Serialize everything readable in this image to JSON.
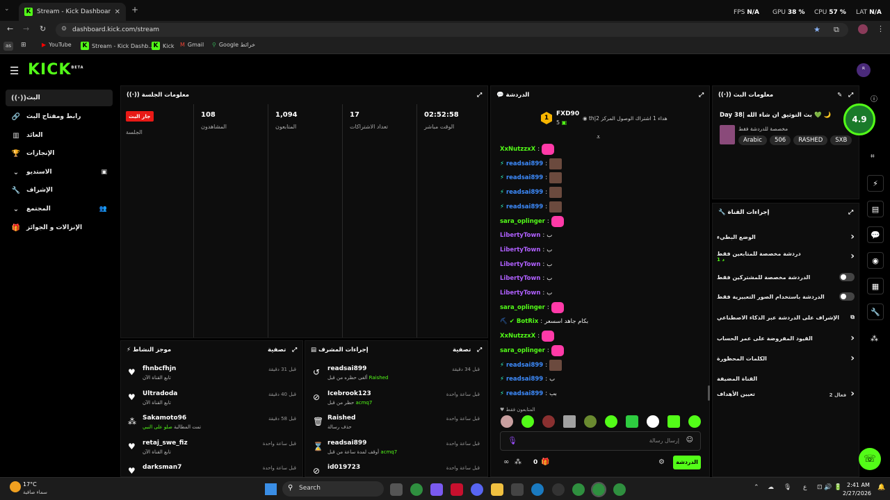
{
  "browser": {
    "tab_title": "Stream - Kick Dashboard",
    "url": "dashboard.kick.com/stream",
    "stats": {
      "fps_label": "FPS",
      "fps": "N/A",
      "gpu_label": "GPU",
      "gpu": "38 %",
      "cpu_label": "CPU",
      "cpu": "57 %",
      "lat_label": "LAT",
      "lat": "N/A"
    },
    "profile_initials": "as",
    "bookmarks": [
      "YouTube",
      "Stream - Kick Dashb...",
      "Kick",
      "Gmail",
      "Google خرائط"
    ]
  },
  "brand": {
    "logo": "KICK",
    "beta": "BETA"
  },
  "sidebar": {
    "items": [
      {
        "label": "البث",
        "icon": "broadcast-icon",
        "glyph": "((·))"
      },
      {
        "label": "رابط ومفتاح البث",
        "icon": "link-icon",
        "glyph": "🔗"
      },
      {
        "label": "العائد",
        "icon": "chart-icon",
        "glyph": "▥"
      },
      {
        "label": "الإنجازات",
        "icon": "trophy-icon",
        "glyph": "🏆"
      },
      {
        "label": "الاستديو",
        "icon": "chevron-down-icon",
        "glyph": "⌄"
      },
      {
        "label": "الإشراف",
        "icon": "wrench-icon",
        "glyph": "🔧"
      },
      {
        "label": "المجتمع",
        "icon": "chevron-down-icon",
        "glyph": "⌄"
      },
      {
        "label": "الإنزالات و الجوائز",
        "icon": "gift-icon",
        "glyph": "🎁"
      }
    ]
  },
  "session": {
    "title": "معلومات الجلسة",
    "live_badge": "جار البث",
    "session_label": "الجلسة",
    "stats": [
      {
        "value": "108",
        "label": "المشاهدون"
      },
      {
        "value": "1,094",
        "label": "المتابعون"
      },
      {
        "value": "17",
        "label": "تعداد الاشتراكات"
      },
      {
        "value": "02:52:58",
        "label": "الوقت مباشر"
      }
    ]
  },
  "chat": {
    "title": "الدردشة",
    "pinned_user": "FXD90",
    "pinned_rank": "1",
    "pinned_count": "5",
    "pinned_note": "th|هداء 1 اشتراك الوصول المركز 2",
    "messages": [
      {
        "user": "XxNutzzxX",
        "color": "green",
        "text": "",
        "emote": "pink"
      },
      {
        "user": "readsai899",
        "color": "blue",
        "text": "",
        "emote": "face"
      },
      {
        "user": "readsai899",
        "color": "blue",
        "text": "",
        "emote": "face"
      },
      {
        "user": "readsai899",
        "color": "blue",
        "text": "",
        "emote": "face"
      },
      {
        "user": "readsai899",
        "color": "blue",
        "text": "",
        "emote": "face"
      },
      {
        "user": "sara_oplinger",
        "color": "green",
        "text": "",
        "emote": "pink"
      },
      {
        "user": "LibertyTown",
        "color": "purple",
        "text": "ب",
        "emote": ""
      },
      {
        "user": "LibertyTown",
        "color": "purple",
        "text": "ب",
        "emote": ""
      },
      {
        "user": "LibertyTown",
        "color": "purple",
        "text": "ب",
        "emote": ""
      },
      {
        "user": "LibertyTown",
        "color": "purple",
        "text": "ب",
        "emote": ""
      },
      {
        "user": "LibertyTown",
        "color": "purple",
        "text": "ب",
        "emote": ""
      },
      {
        "user": "sara_oplinger",
        "color": "green",
        "text": "",
        "emote": "pink"
      },
      {
        "user": "BotRix",
        "color": "green",
        "text": "بكام جاهد اسسعر",
        "emote": ""
      },
      {
        "user": "XxNutzzxX",
        "color": "green",
        "text": "",
        "emote": "pink"
      },
      {
        "user": "sara_oplinger",
        "color": "green",
        "text": "",
        "emote": "pink"
      },
      {
        "user": "readsai899",
        "color": "blue",
        "text": "",
        "emote": "face"
      },
      {
        "user": "readsai899",
        "color": "blue",
        "text": "ب",
        "emote": ""
      },
      {
        "user": "readsai899",
        "color": "blue",
        "text": "بب",
        "emote": ""
      }
    ],
    "followers_only": "المتابعون فقط",
    "input_placeholder": "إرسال رسالة",
    "send_label": "الدردشة",
    "count": "0"
  },
  "activity": {
    "title": "موجز النشاط",
    "filter": "تصفية",
    "events": [
      {
        "user": "fhnbcfhjn",
        "sub": "تابع القناة الآن",
        "time": "قبل 31 دقيقة",
        "icon": "heart-icon",
        "glyph": "♥"
      },
      {
        "user": "Ultradoda",
        "sub": "تابع القناة الآن",
        "time": "قبل 40 دقيقة",
        "icon": "heart-icon",
        "glyph": "♥"
      },
      {
        "user": "Sakamoto96",
        "sub": "تمت المطالبة",
        "hl": "صلو على النبي",
        "time": "قبل 58 دقيقة",
        "icon": "reward-icon",
        "glyph": "⁂"
      },
      {
        "user": "retaj_swe_fiz",
        "sub": "تابع القناة الآن",
        "time": "قبل ساعة واحدة",
        "icon": "heart-icon",
        "glyph": "♥"
      },
      {
        "user": "darksman7",
        "sub": "",
        "time": "قبل ساعة واحدة",
        "icon": "heart-icon",
        "glyph": "♥"
      }
    ]
  },
  "mod_actions": {
    "title": "إجراءات المشرف",
    "filter": "تصفية",
    "events": [
      {
        "user": "readsai899",
        "sub": "ألغى حظره من قبل",
        "hl": "Raished",
        "time": "قبل 34 دقيقة",
        "icon": "undo-icon",
        "glyph": "↺"
      },
      {
        "user": "Icebrook123",
        "sub": "حظر من قبل",
        "hl": "acmq7",
        "time": "قبل ساعة واحدة",
        "icon": "ban-icon",
        "glyph": "⊘"
      },
      {
        "user": "Raished",
        "sub": "حذف رسالة",
        "hl": "",
        "time": "قبل ساعة واحدة",
        "icon": "trash-icon",
        "glyph": "🗑"
      },
      {
        "user": "readsai899",
        "sub": "أوقف لمدة ساعة من قبل",
        "hl": "acmq7",
        "time": "قبل ساعة واحدة",
        "icon": "hourglass-icon",
        "glyph": "⌛"
      },
      {
        "user": "id019723",
        "sub": "",
        "hl": "",
        "time": "قبل ساعة واحدة",
        "icon": "ban-icon",
        "glyph": "⊘"
      }
    ]
  },
  "stream_info": {
    "title": "معلومات البث",
    "stream_title": "Day 38| بث التوثيق ان شاء الله 💚 🌙",
    "subtitle": "مخصصة للدردشة فقط",
    "tags": [
      "SXB",
      "RASHED",
      "506",
      "Arabic"
    ],
    "rating": "4.9"
  },
  "channel_actions": {
    "title": "إجراءات القناة",
    "rows": [
      {
        "label": "الوضع البطيء",
        "control": "chevron",
        "note": ""
      },
      {
        "label": "دردشة مخصصة للمتابعين فقط",
        "control": "chevron",
        "note": "1 د"
      },
      {
        "label": "الدردشة مخصصة للمشتركين فقط",
        "control": "toggle",
        "note": ""
      },
      {
        "label": "الدردشة باستخدام الصور التعبيرية فقط",
        "control": "toggle",
        "note": ""
      },
      {
        "label": "الإشراف على الدردشة عبر الذكاء الاصطناعي",
        "control": "external",
        "note": ""
      },
      {
        "label": "القيود المفروضة على عمر الحساب",
        "control": "chevron",
        "note": ""
      },
      {
        "label": "الكلمات المحظورة",
        "control": "chevron",
        "note": ""
      },
      {
        "label": "القناة المضيفة",
        "control": "none",
        "note": ""
      },
      {
        "label": "تعيين الأهداف",
        "control": "chevron",
        "note": "فعال 2"
      }
    ]
  },
  "taskbar": {
    "temp": "17°C",
    "weather": "سماء صافية",
    "search": "Search",
    "time": "2:41 AM",
    "date": "2/27/2026",
    "lang": "ع"
  },
  "colors": {
    "accent": "#53fc18",
    "live": "#e91916",
    "user_blue": "#3d8bfd",
    "user_purple": "#b060ff"
  }
}
